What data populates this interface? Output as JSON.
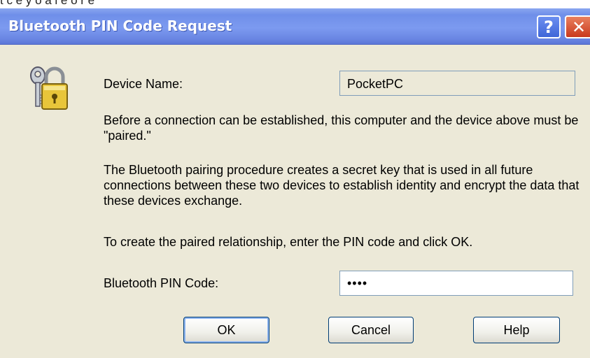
{
  "window": {
    "title": "Bluetooth PIN Code Request"
  },
  "titlebar_buttons": {
    "help": "?",
    "close": "✕"
  },
  "device": {
    "label": "Device Name:",
    "value": "PocketPC"
  },
  "paragraphs": {
    "p1": "Before a connection can be established, this computer and the device above must be \"paired.\"",
    "p2": "The Bluetooth pairing procedure creates a secret key that is used in all future connections between these two devices to establish identity and encrypt the data that these devices exchange.",
    "p3": "To create the paired relationship, enter the PIN code and click OK."
  },
  "pin": {
    "label": "Bluetooth PIN Code:",
    "value": "••••"
  },
  "buttons": {
    "ok": "OK",
    "cancel": "Cancel",
    "help": "Help"
  },
  "top_fragment": "t  c         e  y  o     a   l  e   o   r     e",
  "icons": {
    "dialog_icon": "security-key-lock-icon"
  }
}
